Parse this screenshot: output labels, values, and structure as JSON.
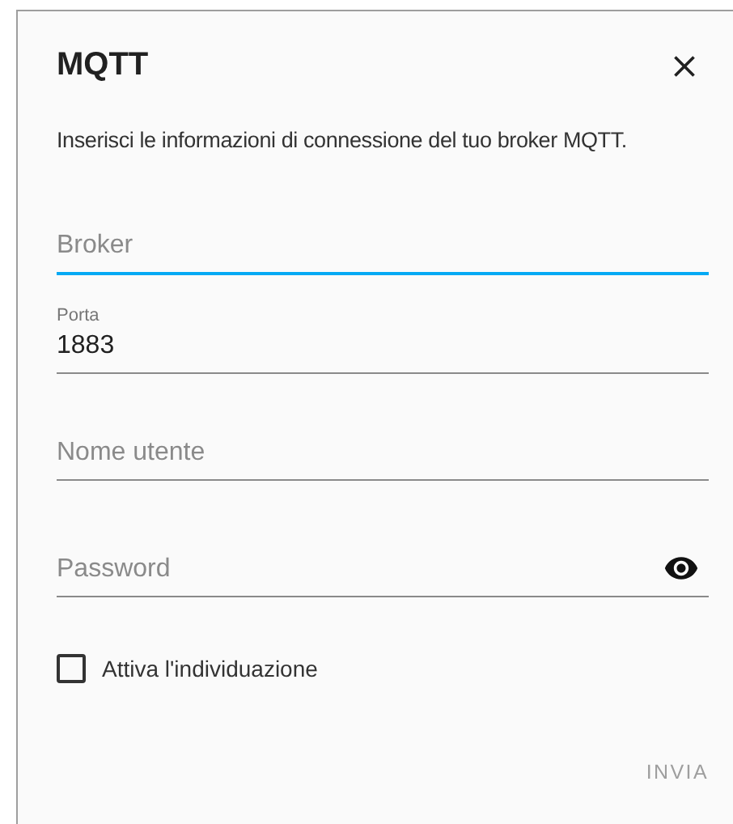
{
  "dialog": {
    "title": "MQTT",
    "description": "Inserisci le informazioni di connessione del tuo broker MQTT.",
    "fields": [
      {
        "kind": "text",
        "placeholder": "Broker",
        "focused": true
      },
      {
        "kind": "text",
        "label": "Porta",
        "value": "1883",
        "focused": false
      },
      {
        "kind": "text",
        "placeholder": "Nome utente",
        "focused": false
      },
      {
        "kind": "password",
        "placeholder": "Password",
        "focused": false
      }
    ],
    "checkbox": {
      "label": "Attiva l'individuazione",
      "checked": false
    },
    "submit": {
      "label": "INVIA",
      "disabled": true
    }
  }
}
